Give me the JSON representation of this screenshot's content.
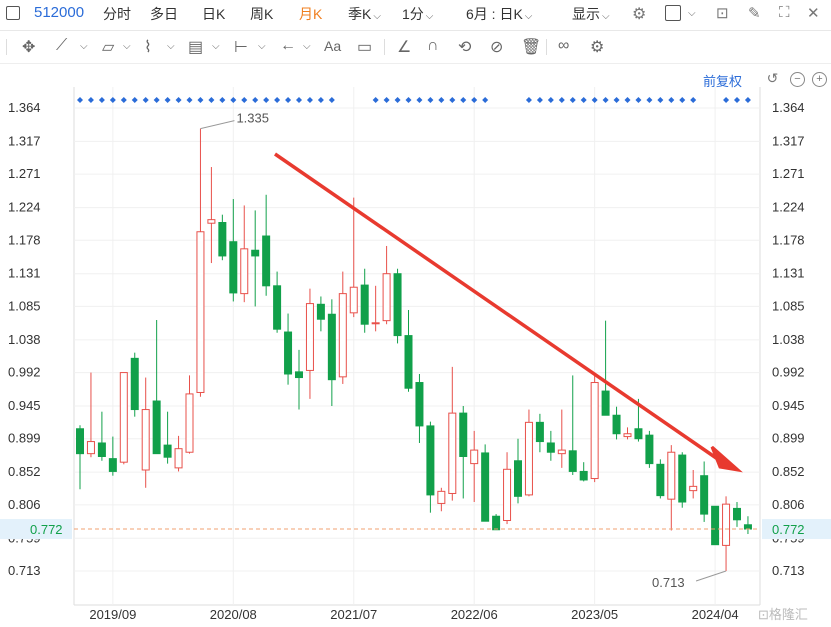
{
  "toolbar_top": {
    "code": "512000",
    "periods": [
      "分时",
      "多日",
      "日K",
      "周K",
      "月K",
      "季K",
      "1分"
    ],
    "active_period": "月K",
    "range_label": "6月 : 日K",
    "display_label": "显示"
  },
  "restore_label": "前复权",
  "chart_data": {
    "type": "candlestick",
    "x_tick_labels": [
      "2019/09",
      "2020/08",
      "2021/07",
      "2022/06",
      "2023/05",
      "2024/04"
    ],
    "y_ticks": [
      1.364,
      1.317,
      1.271,
      1.224,
      1.178,
      1.131,
      1.085,
      1.038,
      0.992,
      0.945,
      0.899,
      0.852,
      0.806,
      0.759,
      0.713
    ],
    "ylim": [
      0.68,
      1.38
    ],
    "current_price": "0.772",
    "max_label": "1.335",
    "min_label": "0.713",
    "up_color": "#e8504a",
    "down_color": "#11a04a",
    "candles": [
      {
        "o": 0.913,
        "h": 0.918,
        "l": 0.828,
        "c": 0.878
      },
      {
        "o": 0.878,
        "h": 0.992,
        "l": 0.873,
        "c": 0.895
      },
      {
        "o": 0.893,
        "h": 0.937,
        "l": 0.868,
        "c": 0.874
      },
      {
        "o": 0.871,
        "h": 0.902,
        "l": 0.847,
        "c": 0.853
      },
      {
        "o": 0.866,
        "h": 0.992,
        "l": 0.863,
        "c": 0.992
      },
      {
        "o": 1.012,
        "h": 1.02,
        "l": 0.93,
        "c": 0.94
      },
      {
        "o": 0.855,
        "h": 0.985,
        "l": 0.83,
        "c": 0.94
      },
      {
        "o": 0.952,
        "h": 1.066,
        "l": 0.878,
        "c": 0.878
      },
      {
        "o": 0.89,
        "h": 0.937,
        "l": 0.864,
        "c": 0.873
      },
      {
        "o": 0.858,
        "h": 0.903,
        "l": 0.853,
        "c": 0.885
      },
      {
        "o": 0.88,
        "h": 0.988,
        "l": 0.878,
        "c": 0.962
      },
      {
        "o": 0.964,
        "h": 1.335,
        "l": 0.958,
        "c": 1.19
      },
      {
        "o": 1.202,
        "h": 1.281,
        "l": 1.146,
        "c": 1.207
      },
      {
        "o": 1.203,
        "h": 1.214,
        "l": 1.15,
        "c": 1.156
      },
      {
        "o": 1.176,
        "h": 1.236,
        "l": 1.092,
        "c": 1.104
      },
      {
        "o": 1.103,
        "h": 1.227,
        "l": 1.091,
        "c": 1.166
      },
      {
        "o": 1.164,
        "h": 1.22,
        "l": 1.085,
        "c": 1.156
      },
      {
        "o": 1.184,
        "h": 1.242,
        "l": 1.1,
        "c": 1.114
      },
      {
        "o": 1.114,
        "h": 1.134,
        "l": 1.048,
        "c": 1.053
      },
      {
        "o": 1.049,
        "h": 1.075,
        "l": 0.975,
        "c": 0.99
      },
      {
        "o": 0.993,
        "h": 1.024,
        "l": 0.94,
        "c": 0.985
      },
      {
        "o": 0.995,
        "h": 1.11,
        "l": 0.955,
        "c": 1.089
      },
      {
        "o": 1.088,
        "h": 1.099,
        "l": 1.05,
        "c": 1.067
      },
      {
        "o": 1.074,
        "h": 1.095,
        "l": 0.945,
        "c": 0.982
      },
      {
        "o": 0.986,
        "h": 1.134,
        "l": 0.976,
        "c": 1.103
      },
      {
        "o": 1.076,
        "h": 1.238,
        "l": 1.07,
        "c": 1.112
      },
      {
        "o": 1.115,
        "h": 1.138,
        "l": 1.048,
        "c": 1.06
      },
      {
        "o": 1.062,
        "h": 1.114,
        "l": 1.05,
        "c": 1.062
      },
      {
        "o": 1.065,
        "h": 1.17,
        "l": 1.06,
        "c": 1.131
      },
      {
        "o": 1.131,
        "h": 1.138,
        "l": 1.033,
        "c": 1.044
      },
      {
        "o": 1.044,
        "h": 1.08,
        "l": 0.965,
        "c": 0.97
      },
      {
        "o": 0.978,
        "h": 0.99,
        "l": 0.893,
        "c": 0.917
      },
      {
        "o": 0.917,
        "h": 0.923,
        "l": 0.795,
        "c": 0.82
      },
      {
        "o": 0.808,
        "h": 0.83,
        "l": 0.797,
        "c": 0.825
      },
      {
        "o": 0.822,
        "h": 1.0,
        "l": 0.812,
        "c": 0.935
      },
      {
        "o": 0.935,
        "h": 0.945,
        "l": 0.815,
        "c": 0.874
      },
      {
        "o": 0.864,
        "h": 0.91,
        "l": 0.81,
        "c": 0.883
      },
      {
        "o": 0.879,
        "h": 0.891,
        "l": 0.783,
        "c": 0.783
      },
      {
        "o": 0.79,
        "h": 0.793,
        "l": 0.771,
        "c": 0.771
      },
      {
        "o": 0.784,
        "h": 0.88,
        "l": 0.779,
        "c": 0.856
      },
      {
        "o": 0.868,
        "h": 0.899,
        "l": 0.808,
        "c": 0.818
      },
      {
        "o": 0.82,
        "h": 0.94,
        "l": 0.818,
        "c": 0.922
      },
      {
        "o": 0.922,
        "h": 0.934,
        "l": 0.88,
        "c": 0.895
      },
      {
        "o": 0.893,
        "h": 0.91,
        "l": 0.868,
        "c": 0.88
      },
      {
        "o": 0.878,
        "h": 0.94,
        "l": 0.858,
        "c": 0.883
      },
      {
        "o": 0.882,
        "h": 0.988,
        "l": 0.848,
        "c": 0.853
      },
      {
        "o": 0.853,
        "h": 0.866,
        "l": 0.839,
        "c": 0.841
      },
      {
        "o": 0.843,
        "h": 0.99,
        "l": 0.838,
        "c": 0.978
      },
      {
        "o": 0.966,
        "h": 1.065,
        "l": 0.932,
        "c": 0.932
      },
      {
        "o": 0.932,
        "h": 0.944,
        "l": 0.898,
        "c": 0.906
      },
      {
        "o": 0.902,
        "h": 0.915,
        "l": 0.898,
        "c": 0.906
      },
      {
        "o": 0.913,
        "h": 0.955,
        "l": 0.895,
        "c": 0.899
      },
      {
        "o": 0.904,
        "h": 0.91,
        "l": 0.858,
        "c": 0.864
      },
      {
        "o": 0.863,
        "h": 0.87,
        "l": 0.815,
        "c": 0.819
      },
      {
        "o": 0.814,
        "h": 0.89,
        "l": 0.77,
        "c": 0.88
      },
      {
        "o": 0.876,
        "h": 0.88,
        "l": 0.802,
        "c": 0.81
      },
      {
        "o": 0.826,
        "h": 0.855,
        "l": 0.815,
        "c": 0.832
      },
      {
        "o": 0.847,
        "h": 0.867,
        "l": 0.782,
        "c": 0.793
      },
      {
        "o": 0.804,
        "h": 0.804,
        "l": 0.75,
        "c": 0.75
      },
      {
        "o": 0.749,
        "h": 0.818,
        "l": 0.713,
        "c": 0.807
      },
      {
        "o": 0.801,
        "h": 0.81,
        "l": 0.775,
        "c": 0.785
      },
      {
        "o": 0.778,
        "h": 0.79,
        "l": 0.765,
        "c": 0.772
      }
    ]
  }
}
